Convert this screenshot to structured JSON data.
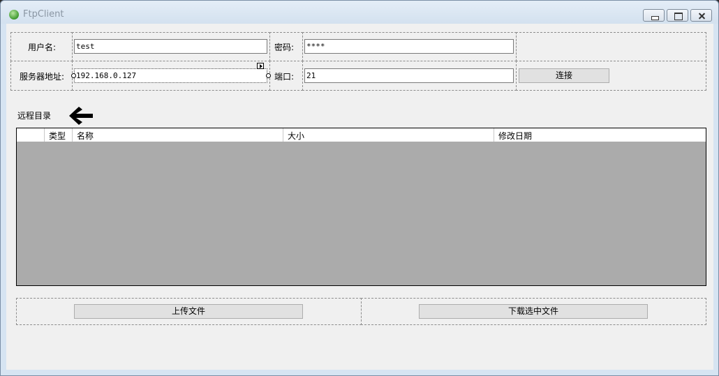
{
  "window": {
    "title": "FtpClient"
  },
  "form": {
    "username_label": "用户名:",
    "username_value": "test",
    "password_label": "密码:",
    "password_value": "****",
    "server_label": "服务器地址:",
    "server_value": "192.168.0.127",
    "port_label": "端口:",
    "port_value": "21",
    "connect_label": "连接"
  },
  "remote": {
    "label": "远程目录",
    "back_icon": "arrow-left-icon",
    "columns": [
      "",
      "类型",
      "名称",
      "大小",
      "修改日期"
    ]
  },
  "actions": {
    "upload_label": "上传文件",
    "download_label": "下载选中文件"
  },
  "colors": {
    "grid_background": "#ababab",
    "client_background": "#f0f0f0"
  }
}
